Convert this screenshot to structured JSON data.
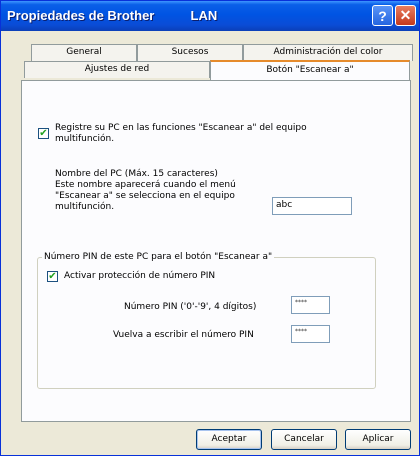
{
  "window": {
    "title": "Propiedades de Brother",
    "title_suffix": "LAN",
    "help_glyph": "?",
    "close_glyph": "✕"
  },
  "tabs": {
    "row1": [
      "General",
      "Sucesos",
      "Administración del color"
    ],
    "row2": [
      "Ajustes de red",
      "Botón \"Escanear a\""
    ],
    "active": "Botón \"Escanear a\""
  },
  "register": {
    "checked": true,
    "label_line1": "Registre su PC en las funciones \"Escanear a\" del equipo",
    "label_line2": "multifunción."
  },
  "pc_name": {
    "label_lines": [
      "Nombre del PC (Máx. 15 caracteres)",
      "Este nombre aparecerá cuando el menú",
      "\"Escanear a\" se selecciona en el equipo",
      "multifunción."
    ],
    "value": "abc"
  },
  "pin_group": {
    "title": "Número PIN de este PC para el botón \"Escanear a\"",
    "protect_checked": true,
    "protect_label": "Activar protección de número PIN",
    "pin_label": "Número PIN ('0'-'9', 4 dígitos)",
    "pin_value": "****",
    "repeat_label": "Vuelva a escribir el número PIN",
    "repeat_value": "****"
  },
  "buttons": {
    "ok": "Aceptar",
    "cancel": "Cancelar",
    "apply": "Aplicar"
  },
  "colors": {
    "title_bar": "#0054e3",
    "active_tab_accent": "#e68b2c",
    "dialog_bg": "#ece9d8"
  }
}
